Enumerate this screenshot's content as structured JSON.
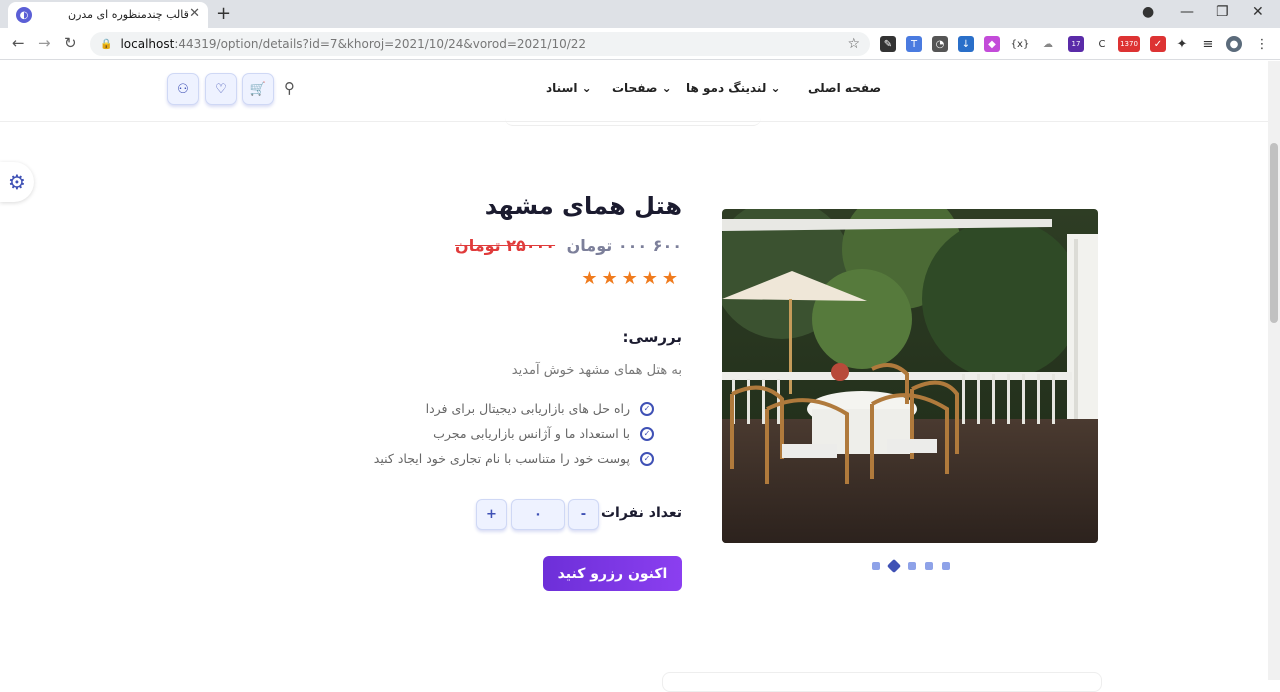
{
  "browser": {
    "tab_title": "قالب چندمنظوره ای مدرن",
    "new_tab": "+",
    "url_host": "localhost",
    "url_path": ":44319/option/details?id=7&khoroj=2021/10/24&vorod=2021/10/22",
    "ext_badges": [
      "17",
      "1370"
    ]
  },
  "header": {
    "nav": [
      "صفحه اصلی",
      "لندینگ دمو ها",
      "صفحات",
      "اسناد"
    ],
    "icons": [
      "user-icon",
      "heart-icon",
      "cart-icon",
      "search-icon"
    ]
  },
  "product": {
    "title": "هتل همای مشهد",
    "price": "۶۰۰ ۰۰۰ تومان",
    "old_price": "۲۵۰۰۰ تومان",
    "stars": "★★★★★",
    "rating": 5,
    "review_label": "بررسی:",
    "welcome": "به هتل همای مشهد خوش آمدید",
    "features": [
      "راه حل های بازاریابی دیجیتال برای فردا",
      "با استعداد ما و آژانس بازاریابی مجرب",
      "پوست خود را متناسب با نام تجاری خود ایجاد کنید"
    ],
    "people_label": "تعداد نفرات :",
    "quantity": "۰",
    "minus": "-",
    "plus": "+",
    "book_label": "اکنون رزرو کنید"
  },
  "carousel": {
    "count": 5,
    "active": 2
  },
  "colors": {
    "accent": "#3f51b5",
    "button": "#7b36e6",
    "star": "#f07b1d",
    "old_price": "#e03b3b"
  }
}
